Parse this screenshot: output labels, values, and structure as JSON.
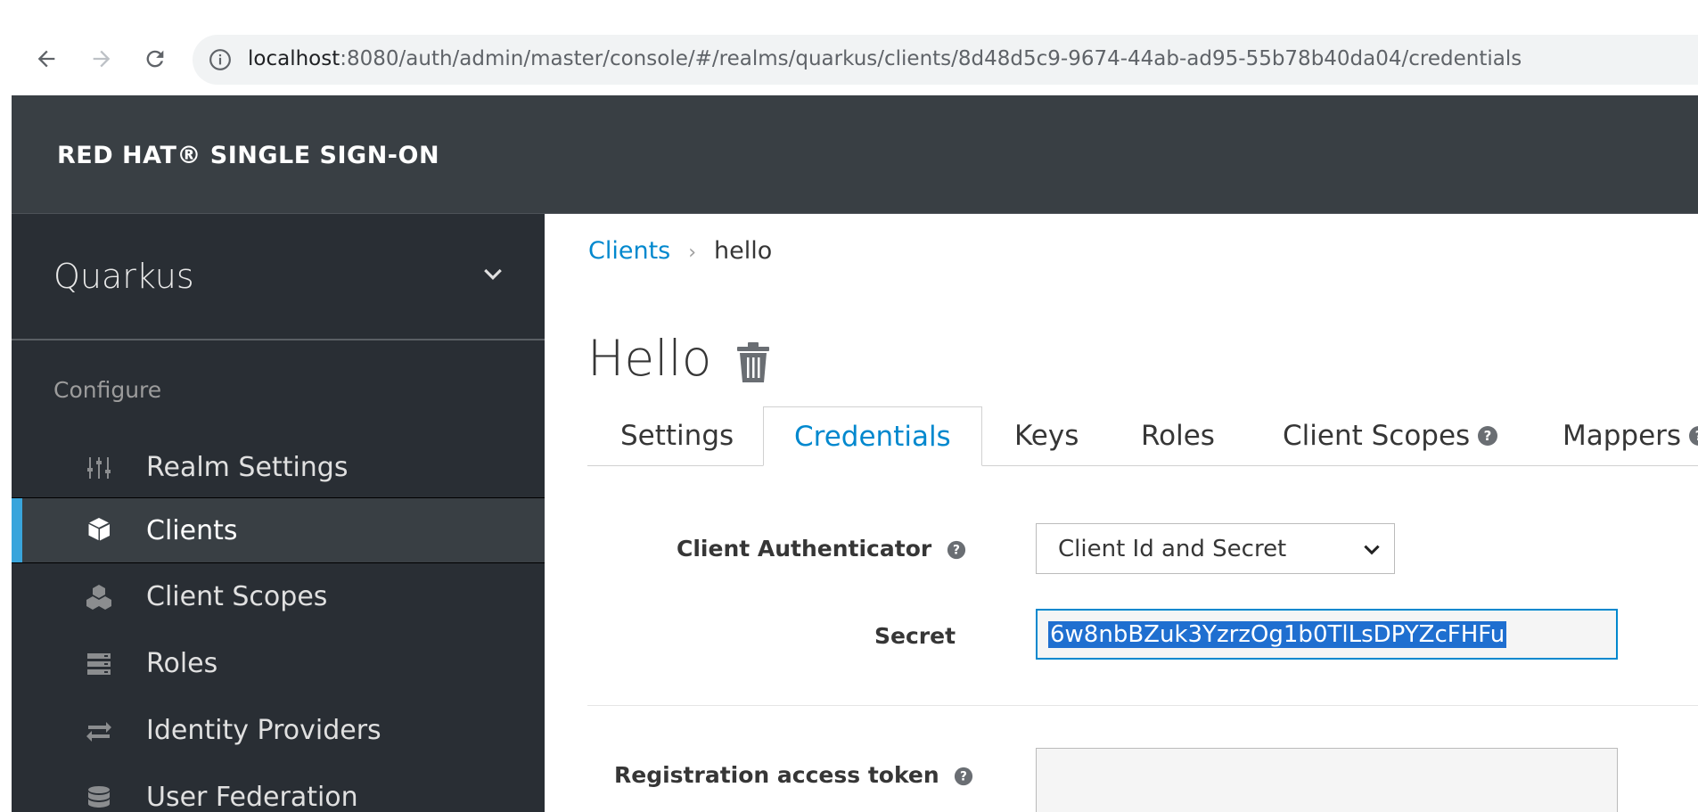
{
  "browser": {
    "url_host": "localhost",
    "url_rest": ":8080/auth/admin/master/console/#/realms/quarkus/clients/8d48d5c9-9674-44ab-ad95-55b78b40da04/credentials"
  },
  "header": {
    "brand": "RED HAT® SINGLE SIGN-ON"
  },
  "sidebar": {
    "realm": "Quarkus",
    "section": "Configure",
    "items": [
      {
        "label": "Realm Settings",
        "icon": "sliders-icon"
      },
      {
        "label": "Clients",
        "icon": "cube-icon",
        "active": true
      },
      {
        "label": "Client Scopes",
        "icon": "cubes-icon"
      },
      {
        "label": "Roles",
        "icon": "server-icon"
      },
      {
        "label": "Identity Providers",
        "icon": "exchange-icon"
      },
      {
        "label": "User Federation",
        "icon": "database-icon"
      }
    ]
  },
  "breadcrumb": {
    "parent": "Clients",
    "current": "hello"
  },
  "page": {
    "title": "Hello"
  },
  "tabs": [
    {
      "label": "Settings"
    },
    {
      "label": "Credentials",
      "active": true
    },
    {
      "label": "Keys"
    },
    {
      "label": "Roles"
    },
    {
      "label": "Client Scopes"
    },
    {
      "label": "Mappers"
    }
  ],
  "form": {
    "authenticator_label": "Client Authenticator",
    "authenticator_value": "Client Id and Secret",
    "secret_label": "Secret",
    "secret_value": "6w8nbBZuk3YzrzOg1b0TlLsDPYZcFHFu",
    "registration_label": "Registration access token"
  },
  "colors": {
    "accent": "#0088ce",
    "sidebar_bg": "#292e34",
    "header_bg": "#393f44"
  }
}
